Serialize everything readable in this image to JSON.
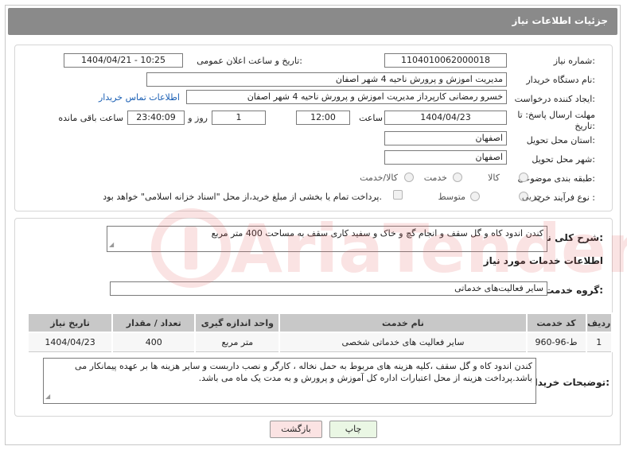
{
  "header": {
    "title": "جزئیات اطلاعات نیاز"
  },
  "labels": {
    "need_number": "شماره نیاز:",
    "announce_datetime": "تاریخ و ساعت اعلان عمومی:",
    "buyer_org": "نام دستگاه خریدار:",
    "requester": "ایجاد کننده درخواست:",
    "deadline": "مهلت ارسال پاسخ: تا",
    "deadline_date_word": "تاریخ:",
    "time_word": "ساعت",
    "day_and": "روز و",
    "remaining_time": "ساعت باقی مانده",
    "province": "استان محل تحویل:",
    "city": "شهر محل تحویل:",
    "category": "طبقه بندی موضوعی:",
    "process_type": "نوع فرآیند خرید :",
    "general_desc": "شرح کلی نیاز:",
    "services_info": "اطلاعات خدمات مورد نیاز",
    "service_group": "گروه خدمت:",
    "buyer_notes": "توضیحات خریدار:"
  },
  "values": {
    "need_number": "1104010062000018",
    "announce_datetime": "1404/04/21 - 10:25",
    "buyer_org": "مدیریت اموزش و پرورش ناحیه 4 شهر اصفان",
    "requester": "خسرو رمضانی کارپرداز مدیریت اموزش و پرورش ناحیه 4 شهر اصفان",
    "contact_link": "اطلاعات تماس خریدار",
    "deadline_date": "1404/04/23",
    "deadline_time": "12:00",
    "days": "1",
    "remaining": "23:40:09",
    "province": "اصفهان",
    "city": "اصفهان",
    "general_desc": "کندن اندود کاه و گل سقف و انجام گچ و خاک و سفید کاری سقف به مساحت 400 متر مربع",
    "service_group": "سایر فعالیت‌های خدماتی",
    "buyer_notes": "کندن اندود کاه و گل سقف ،کلیه هزینه های مربوط به  حمل نخاله  ، کارگر و نصب داربست و سایر هزینه ها بر عهده پیمانکار می باشد.پرداخت هزینه از محل اعتبارات اداره کل آموزش و پرورش و به مدت یک ماه می باشد."
  },
  "category_options": [
    "کالا",
    "خدمت",
    "کالا/خدمت"
  ],
  "process_options": [
    "جزیی",
    "متوسط"
  ],
  "payment_note": "پرداخت تمام یا بخشی از مبلغ خرید،از محل \"اسناد خزانه اسلامی\" خواهد بود.",
  "table": {
    "headers": [
      "ردیف",
      "کد خدمت",
      "نام خدمت",
      "واحد اندازه گیری",
      "تعداد / مقدار",
      "تاریخ نیاز"
    ],
    "rows": [
      [
        "1",
        "ط-96-960",
        "سایر فعالیت های خدماتی شخصی",
        "متر مربع",
        "400",
        "1404/04/23"
      ]
    ]
  },
  "buttons": {
    "print": "چاپ",
    "back": "بازگشت"
  },
  "watermark": {
    "text": "AriaTender.neT"
  },
  "colors": {
    "header_bg": "#8a8a8a",
    "link": "#1a5fb4",
    "print_btn": "#eaf7e4",
    "back_btn": "#fbe3e3",
    "watermark": "#e46a6a"
  }
}
